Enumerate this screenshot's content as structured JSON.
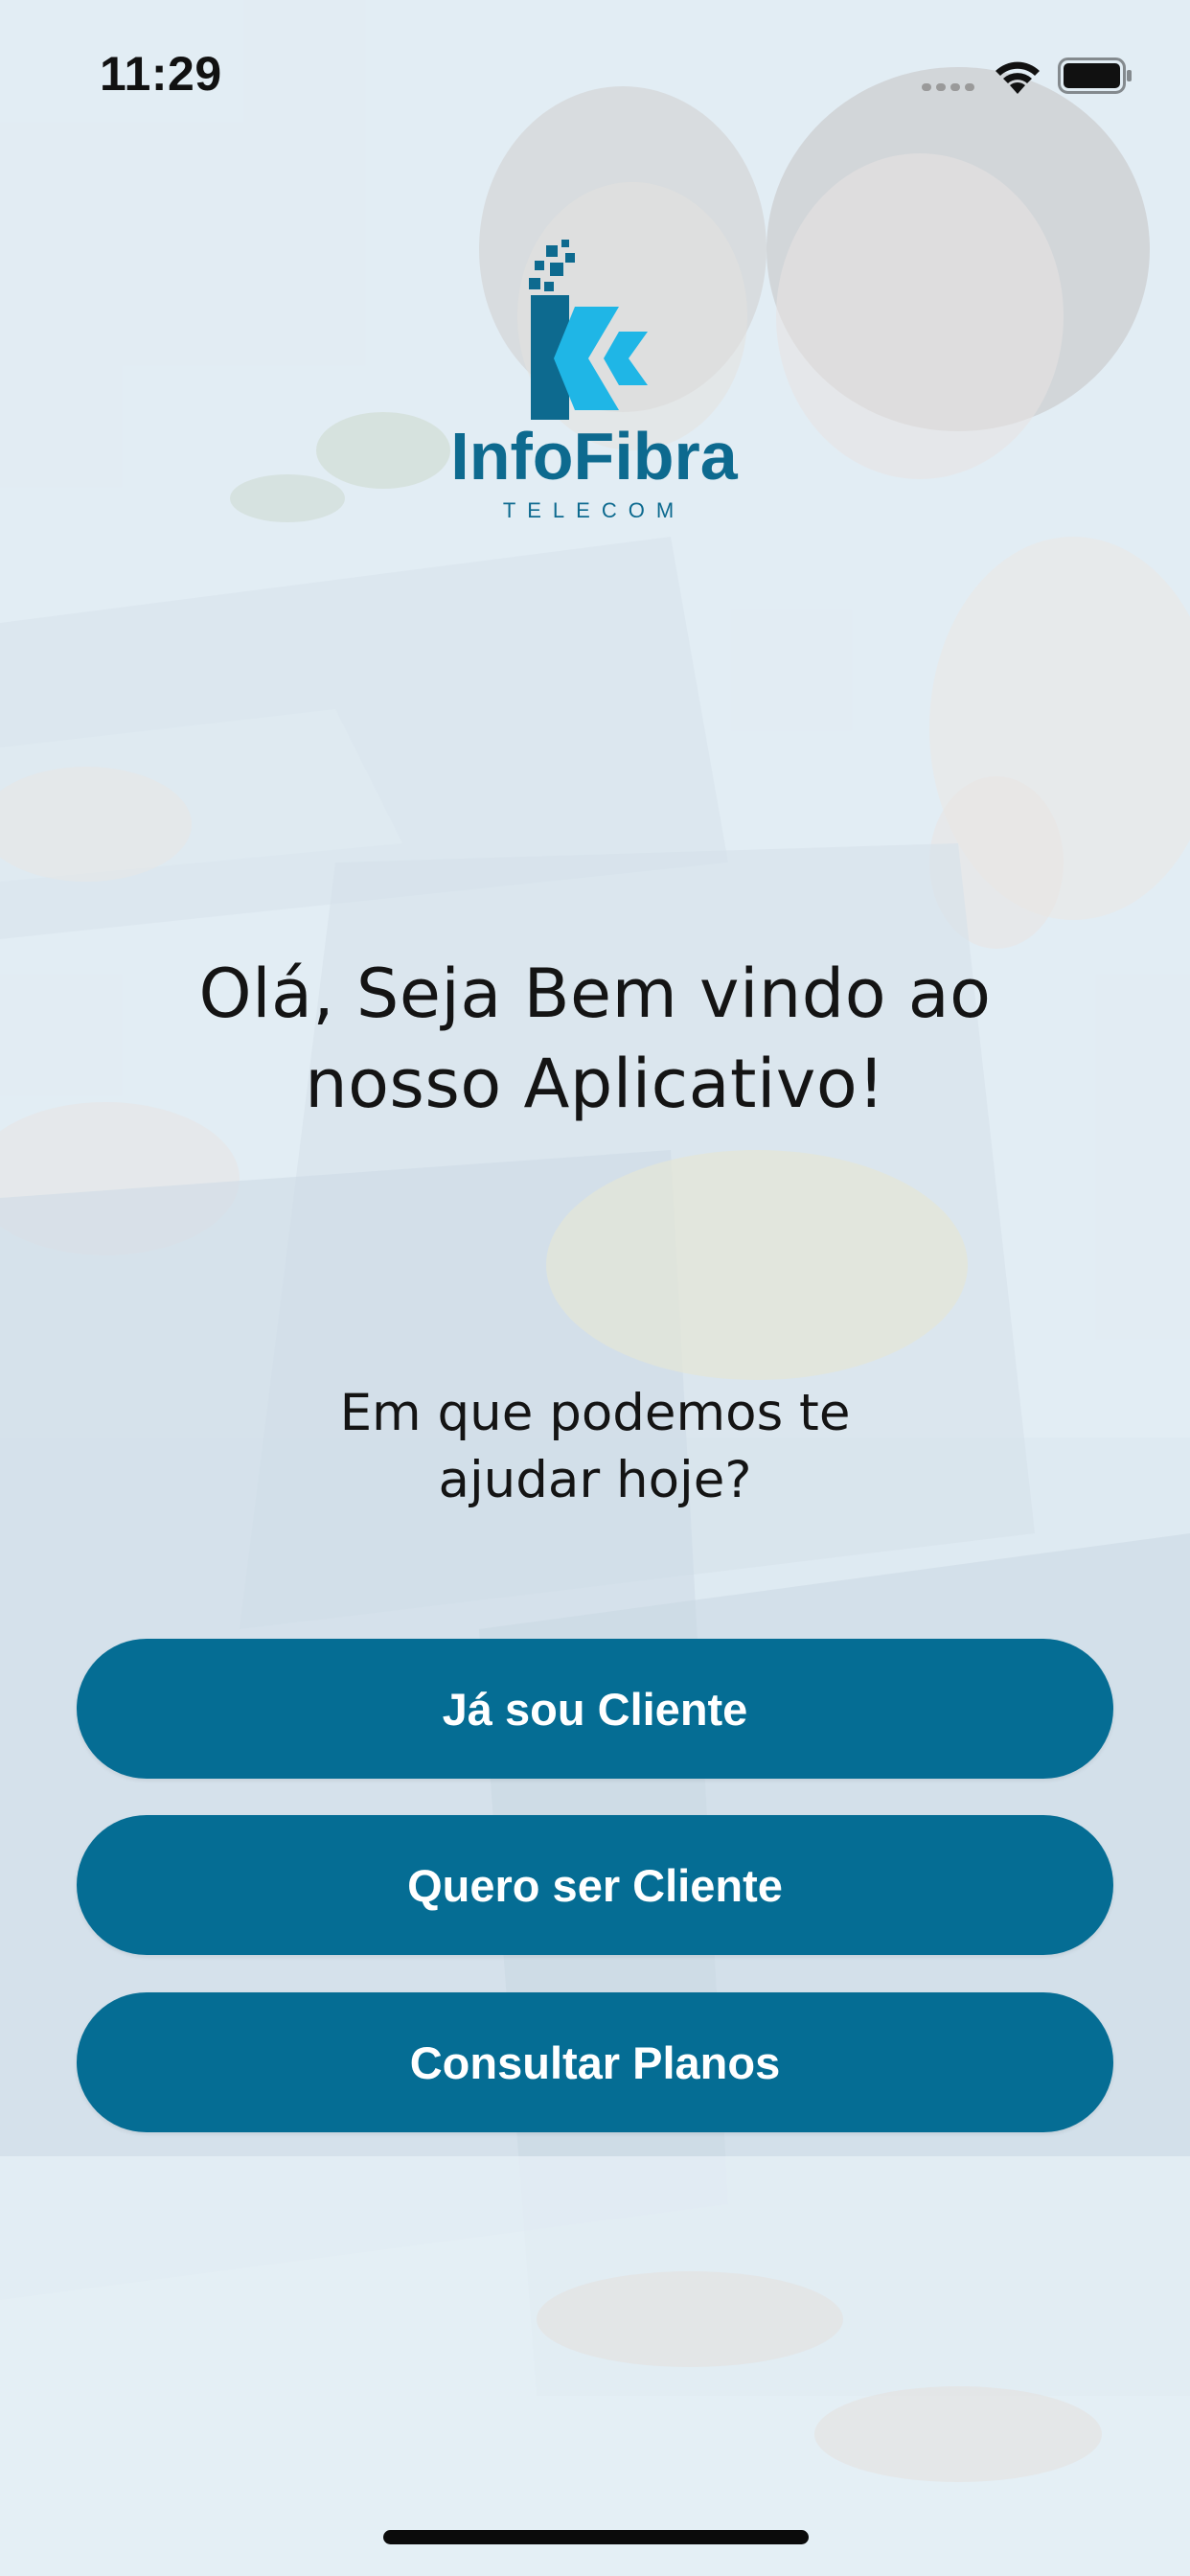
{
  "status_bar": {
    "time": "11:29"
  },
  "logo": {
    "brand_name": "InfoFibra",
    "brand_sub": "TELECOM",
    "brand_dark": "#0d6a8f",
    "brand_light": "#1fb6e6"
  },
  "welcome": {
    "line1": "Olá, Seja Bem vindo ao",
    "line2": "nosso Aplicativo!"
  },
  "prompt": {
    "line1": "Em que podemos te",
    "line2": "ajudar hoje?"
  },
  "buttons": {
    "existing_client": "Já sou Cliente",
    "new_client": "Quero ser Cliente",
    "plans": "Consultar Planos"
  },
  "colors": {
    "button_bg": "#056d94",
    "button_text": "#ffffff"
  }
}
